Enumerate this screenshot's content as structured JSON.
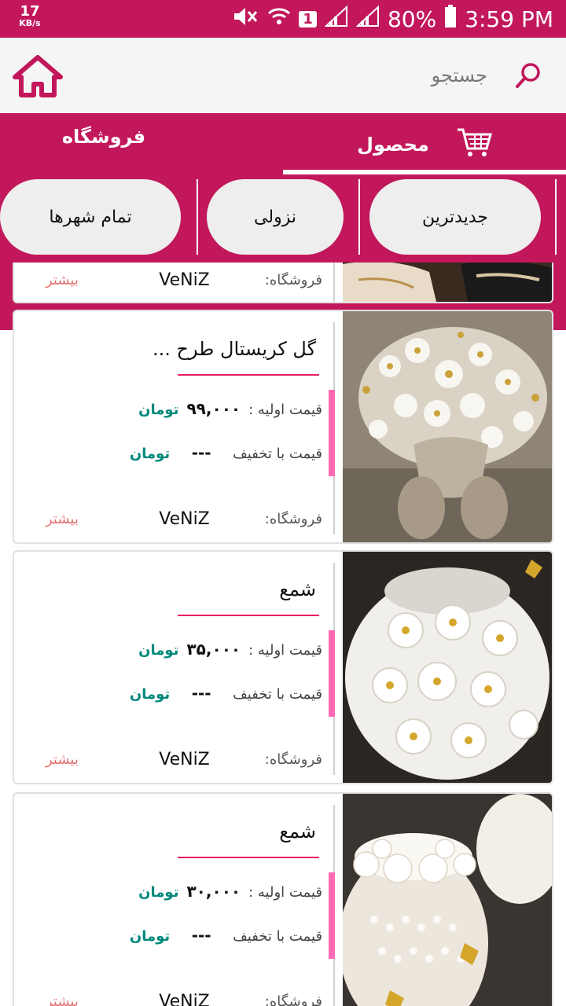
{
  "status_bar": {
    "speed_value": "17",
    "speed_unit": "KB/s",
    "sim_badge": "1",
    "battery": "80%",
    "time": "3:59 PM"
  },
  "search": {
    "placeholder": "جستجو"
  },
  "tabs": [
    {
      "label": "محصول",
      "active": true
    },
    {
      "label": "فروشگاه",
      "active": false
    }
  ],
  "filters": [
    {
      "label": "جدیدترین"
    },
    {
      "label": "نزولی"
    },
    {
      "label": "تمام شهرها"
    }
  ],
  "labels": {
    "initial_price": "قیمت اولیه :",
    "discount_price": "قیمت با تخفیف",
    "currency": "تومان",
    "shop": "فروشگاه:",
    "more": "بیشتر"
  },
  "products": [
    {
      "title": "",
      "initial_price": "",
      "discount_price": "",
      "shop": "VeNiZ"
    },
    {
      "title": "گل کریستال طرح ...",
      "initial_price": "۹۹,۰۰۰",
      "discount_price": "---",
      "shop": "VeNiZ"
    },
    {
      "title": "شمع",
      "initial_price": "۳۵,۰۰۰",
      "discount_price": "---",
      "shop": "VeNiZ"
    },
    {
      "title": "شمع",
      "initial_price": "۳۰,۰۰۰",
      "discount_price": "---",
      "shop": "VeNiZ"
    }
  ],
  "colors": {
    "primary": "#c2185b",
    "accent": "#ff69b4",
    "currency": "#00897b",
    "more": "#e57373"
  }
}
